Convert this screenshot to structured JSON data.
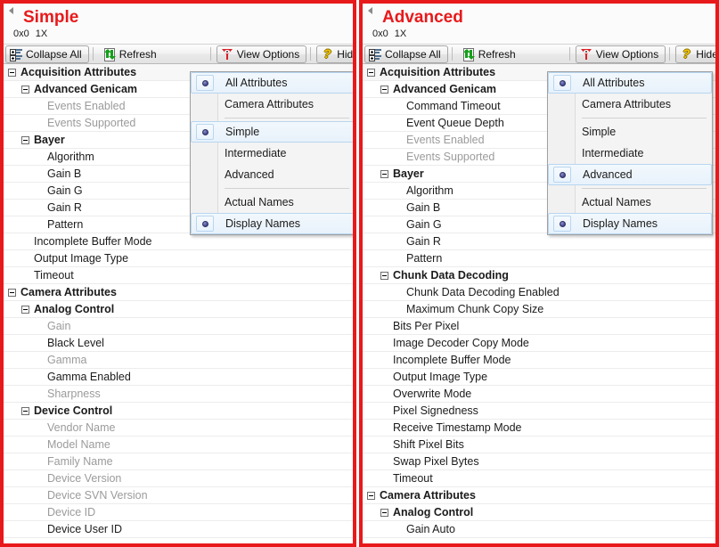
{
  "panels": [
    {
      "header": {
        "title": "Simple",
        "resolution": "0x0",
        "zoom": "1X"
      },
      "toolbar": {
        "collapse_all": "Collapse All",
        "refresh": "Refresh",
        "view_options": "View Options",
        "hide_help": "Hide Help"
      },
      "menu": {
        "items": [
          {
            "label": "All Attributes",
            "selected": true,
            "divider_after": false
          },
          {
            "label": "Camera Attributes",
            "selected": false,
            "divider_after": true
          },
          {
            "label": "Simple",
            "selected": true,
            "divider_after": false
          },
          {
            "label": "Intermediate",
            "selected": false,
            "divider_after": false
          },
          {
            "label": "Advanced",
            "selected": false,
            "divider_after": true
          },
          {
            "label": "Actual Names",
            "selected": false,
            "divider_after": false
          },
          {
            "label": "Display Names",
            "selected": true,
            "divider_after": false
          }
        ]
      },
      "tree": [
        {
          "label": "Acquisition Attributes",
          "level": 0,
          "expandable": true,
          "bold": true,
          "dim": false,
          "header": true
        },
        {
          "label": "Advanced Genicam",
          "level": 1,
          "expandable": true,
          "bold": true,
          "dim": false,
          "header": false
        },
        {
          "label": "Events Enabled",
          "level": 2,
          "expandable": false,
          "bold": false,
          "dim": true,
          "header": false
        },
        {
          "label": "Events Supported",
          "level": 2,
          "expandable": false,
          "bold": false,
          "dim": true,
          "header": false
        },
        {
          "label": "Bayer",
          "level": 1,
          "expandable": true,
          "bold": true,
          "dim": false,
          "header": false
        },
        {
          "label": "Algorithm",
          "level": 2,
          "expandable": false,
          "bold": false,
          "dim": false,
          "header": false
        },
        {
          "label": "Gain B",
          "level": 2,
          "expandable": false,
          "bold": false,
          "dim": false,
          "header": false
        },
        {
          "label": "Gain G",
          "level": 2,
          "expandable": false,
          "bold": false,
          "dim": false,
          "header": false
        },
        {
          "label": "Gain R",
          "level": 2,
          "expandable": false,
          "bold": false,
          "dim": false,
          "header": false
        },
        {
          "label": "Pattern",
          "level": 2,
          "expandable": false,
          "bold": false,
          "dim": false,
          "header": false
        },
        {
          "label": "Incomplete Buffer Mode",
          "level": 1,
          "expandable": false,
          "bold": false,
          "dim": false,
          "header": false
        },
        {
          "label": "Output Image Type",
          "level": 1,
          "expandable": false,
          "bold": false,
          "dim": false,
          "header": false
        },
        {
          "label": "Timeout",
          "level": 1,
          "expandable": false,
          "bold": false,
          "dim": false,
          "header": false
        },
        {
          "label": "Camera Attributes",
          "level": 0,
          "expandable": true,
          "bold": true,
          "dim": false,
          "header": false
        },
        {
          "label": "Analog Control",
          "level": 1,
          "expandable": true,
          "bold": true,
          "dim": false,
          "header": false
        },
        {
          "label": "Gain",
          "level": 2,
          "expandable": false,
          "bold": false,
          "dim": true,
          "header": false
        },
        {
          "label": "Black Level",
          "level": 2,
          "expandable": false,
          "bold": false,
          "dim": false,
          "header": false
        },
        {
          "label": "Gamma",
          "level": 2,
          "expandable": false,
          "bold": false,
          "dim": true,
          "header": false
        },
        {
          "label": "Gamma Enabled",
          "level": 2,
          "expandable": false,
          "bold": false,
          "dim": false,
          "header": false
        },
        {
          "label": "Sharpness",
          "level": 2,
          "expandable": false,
          "bold": false,
          "dim": true,
          "header": false
        },
        {
          "label": "Device Control",
          "level": 1,
          "expandable": true,
          "bold": true,
          "dim": false,
          "header": false
        },
        {
          "label": "Vendor Name",
          "level": 2,
          "expandable": false,
          "bold": false,
          "dim": true,
          "header": false
        },
        {
          "label": "Model Name",
          "level": 2,
          "expandable": false,
          "bold": false,
          "dim": true,
          "header": false
        },
        {
          "label": "Family Name",
          "level": 2,
          "expandable": false,
          "bold": false,
          "dim": true,
          "header": false
        },
        {
          "label": "Device Version",
          "level": 2,
          "expandable": false,
          "bold": false,
          "dim": true,
          "header": false
        },
        {
          "label": "Device SVN Version",
          "level": 2,
          "expandable": false,
          "bold": false,
          "dim": true,
          "header": false
        },
        {
          "label": "Device ID",
          "level": 2,
          "expandable": false,
          "bold": false,
          "dim": true,
          "header": false
        },
        {
          "label": "Device User ID",
          "level": 2,
          "expandable": false,
          "bold": false,
          "dim": false,
          "header": false
        }
      ]
    },
    {
      "header": {
        "title": "Advanced",
        "resolution": "0x0",
        "zoom": "1X"
      },
      "toolbar": {
        "collapse_all": "Collapse All",
        "refresh": "Refresh",
        "view_options": "View Options",
        "hide_help": "Hide Help"
      },
      "menu": {
        "items": [
          {
            "label": "All Attributes",
            "selected": true,
            "divider_after": false
          },
          {
            "label": "Camera Attributes",
            "selected": false,
            "divider_after": true
          },
          {
            "label": "Simple",
            "selected": false,
            "divider_after": false
          },
          {
            "label": "Intermediate",
            "selected": false,
            "divider_after": false
          },
          {
            "label": "Advanced",
            "selected": true,
            "divider_after": true
          },
          {
            "label": "Actual Names",
            "selected": false,
            "divider_after": false
          },
          {
            "label": "Display Names",
            "selected": true,
            "divider_after": false
          }
        ]
      },
      "tree": [
        {
          "label": "Acquisition Attributes",
          "level": 0,
          "expandable": true,
          "bold": true,
          "dim": false,
          "header": true
        },
        {
          "label": "Advanced Genicam",
          "level": 1,
          "expandable": true,
          "bold": true,
          "dim": false,
          "header": false
        },
        {
          "label": "Command Timeout",
          "level": 2,
          "expandable": false,
          "bold": false,
          "dim": false,
          "header": false
        },
        {
          "label": "Event Queue Depth",
          "level": 2,
          "expandable": false,
          "bold": false,
          "dim": false,
          "header": false
        },
        {
          "label": "Events Enabled",
          "level": 2,
          "expandable": false,
          "bold": false,
          "dim": true,
          "header": false
        },
        {
          "label": "Events Supported",
          "level": 2,
          "expandable": false,
          "bold": false,
          "dim": true,
          "header": false
        },
        {
          "label": "Bayer",
          "level": 1,
          "expandable": true,
          "bold": true,
          "dim": false,
          "header": false
        },
        {
          "label": "Algorithm",
          "level": 2,
          "expandable": false,
          "bold": false,
          "dim": false,
          "header": false
        },
        {
          "label": "Gain B",
          "level": 2,
          "expandable": false,
          "bold": false,
          "dim": false,
          "header": false
        },
        {
          "label": "Gain G",
          "level": 2,
          "expandable": false,
          "bold": false,
          "dim": false,
          "header": false
        },
        {
          "label": "Gain R",
          "level": 2,
          "expandable": false,
          "bold": false,
          "dim": false,
          "header": false
        },
        {
          "label": "Pattern",
          "level": 2,
          "expandable": false,
          "bold": false,
          "dim": false,
          "header": false
        },
        {
          "label": "Chunk Data Decoding",
          "level": 1,
          "expandable": true,
          "bold": true,
          "dim": false,
          "header": false
        },
        {
          "label": "Chunk Data Decoding Enabled",
          "level": 2,
          "expandable": false,
          "bold": false,
          "dim": false,
          "header": false
        },
        {
          "label": "Maximum Chunk Copy Size",
          "level": 2,
          "expandable": false,
          "bold": false,
          "dim": false,
          "header": false
        },
        {
          "label": "Bits Per Pixel",
          "level": 1,
          "expandable": false,
          "bold": false,
          "dim": false,
          "header": false
        },
        {
          "label": "Image Decoder Copy Mode",
          "level": 1,
          "expandable": false,
          "bold": false,
          "dim": false,
          "header": false
        },
        {
          "label": "Incomplete Buffer Mode",
          "level": 1,
          "expandable": false,
          "bold": false,
          "dim": false,
          "header": false
        },
        {
          "label": "Output Image Type",
          "level": 1,
          "expandable": false,
          "bold": false,
          "dim": false,
          "header": false
        },
        {
          "label": "Overwrite Mode",
          "level": 1,
          "expandable": false,
          "bold": false,
          "dim": false,
          "header": false
        },
        {
          "label": "Pixel Signedness",
          "level": 1,
          "expandable": false,
          "bold": false,
          "dim": false,
          "header": false
        },
        {
          "label": "Receive Timestamp Mode",
          "level": 1,
          "expandable": false,
          "bold": false,
          "dim": false,
          "header": false
        },
        {
          "label": "Shift Pixel Bits",
          "level": 1,
          "expandable": false,
          "bold": false,
          "dim": false,
          "header": false
        },
        {
          "label": "Swap Pixel Bytes",
          "level": 1,
          "expandable": false,
          "bold": false,
          "dim": false,
          "header": false
        },
        {
          "label": "Timeout",
          "level": 1,
          "expandable": false,
          "bold": false,
          "dim": false,
          "header": false
        },
        {
          "label": "Camera Attributes",
          "level": 0,
          "expandable": true,
          "bold": true,
          "dim": false,
          "header": false
        },
        {
          "label": "Analog Control",
          "level": 1,
          "expandable": true,
          "bold": true,
          "dim": false,
          "header": false
        },
        {
          "label": "Gain Auto",
          "level": 2,
          "expandable": false,
          "bold": false,
          "dim": false,
          "header": false
        }
      ]
    }
  ],
  "colors": {
    "annotation_border": "#e8191b",
    "title": "#e8191b",
    "dim_text": "#9b9b9b",
    "row_separator": "#ececec",
    "selection_border": "#b8d6f0"
  }
}
